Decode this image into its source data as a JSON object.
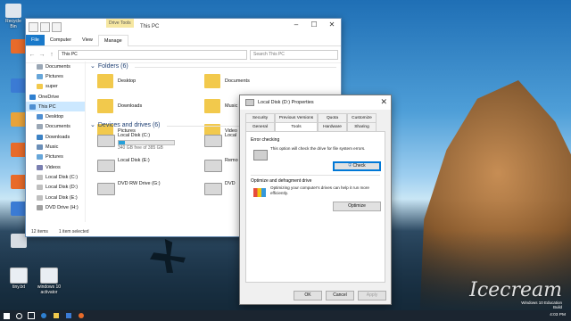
{
  "desktop": {
    "icons": [
      {
        "label": "Recycle Bin",
        "color": "#dfe6ee"
      },
      {
        "label": "",
        "color": "#e86b2a"
      },
      {
        "label": "",
        "color": "#3b7bd4"
      },
      {
        "label": "",
        "color": "#e8a33a"
      },
      {
        "label": "",
        "color": "#e86b2a"
      },
      {
        "label": "",
        "color": "#e86b2a"
      },
      {
        "label": "",
        "color": "#3b7bd4"
      },
      {
        "label": "",
        "color": "#d7dde3"
      },
      {
        "label": "",
        "color": "#e0e0e0"
      }
    ],
    "bottom_icons": [
      {
        "label": "tiny.txt",
        "color": "#e9eef3"
      },
      {
        "label": "windows 10 activator",
        "color": "#e9eef3"
      }
    ],
    "watermark": "Icecream",
    "edition": [
      "Windows 10 Education",
      "Build"
    ]
  },
  "explorer": {
    "title": "This PC",
    "context_tab": "Drive Tools",
    "ribbon_tabs": [
      "File",
      "Computer",
      "View",
      "Manage"
    ],
    "address": "This PC",
    "search_placeholder": "Search This PC",
    "nav": [
      {
        "label": "Documents",
        "root": false,
        "color": "#9aa7b5"
      },
      {
        "label": "Pictures",
        "root": false,
        "color": "#67a6d9"
      },
      {
        "label": "super",
        "root": false,
        "color": "#f2c94c"
      },
      {
        "label": "OneDrive",
        "root": true,
        "color": "#2f80d1"
      },
      {
        "label": "This PC",
        "root": true,
        "color": "#4f8fd1",
        "selected": true
      },
      {
        "label": "Desktop",
        "root": false,
        "color": "#4f8fd1"
      },
      {
        "label": "Documents",
        "root": false,
        "color": "#9aa7b5"
      },
      {
        "label": "Downloads",
        "root": false,
        "color": "#3c82c4"
      },
      {
        "label": "Music",
        "root": false,
        "color": "#6b8fb8"
      },
      {
        "label": "Pictures",
        "root": false,
        "color": "#67a6d9"
      },
      {
        "label": "Videos",
        "root": false,
        "color": "#7a7fb0"
      },
      {
        "label": "Local Disk (C:)",
        "root": false,
        "color": "#bfbfbf"
      },
      {
        "label": "Local Disk (D:)",
        "root": false,
        "color": "#bfbfbf"
      },
      {
        "label": "Local Disk (E:)",
        "root": false,
        "color": "#bfbfbf"
      },
      {
        "label": "DVD Drive (H:)",
        "root": false,
        "color": "#a0a0a0"
      }
    ],
    "folders_header": "Folders (6)",
    "folders": [
      "Desktop",
      "Documents",
      "Downloads",
      "Music",
      "Pictures",
      "Video"
    ],
    "drives_header": "Devices and drives (6)",
    "drives": [
      {
        "label": "Local Disk (C:)",
        "free": "340 GB free of 385 GB",
        "fill": 0.12
      },
      {
        "label": "Local Disk (E:)",
        "free": "",
        "fill": null
      },
      {
        "label": "DVD RW Drive (G:)",
        "free": "",
        "fill": null
      },
      {
        "label": "Local",
        "free": "",
        "fill": null
      },
      {
        "label": "Remo",
        "free": "",
        "fill": null
      },
      {
        "label": "DVD",
        "free": "",
        "fill": null
      }
    ],
    "status": [
      "12 items",
      "1 item selected"
    ]
  },
  "props": {
    "title": "Local Disk (D:) Properties",
    "tabs_row1": [
      "Security",
      "Previous Versions",
      "Quota",
      "Customize"
    ],
    "tabs_row2": [
      "General",
      "Tools",
      "Hardware",
      "Sharing"
    ],
    "error_header": "Error checking",
    "error_text": "This option will check the drive for file system errors.",
    "check_btn": "Check",
    "opt_header": "Optimize and defragment drive",
    "opt_text": "Optimizing your computer's drives can help it run more efficiently.",
    "optimize_btn": "Optimize",
    "ok": "OK",
    "cancel": "Cancel",
    "apply": "Apply"
  },
  "taskbar": {
    "clock": "4:03 PM"
  }
}
